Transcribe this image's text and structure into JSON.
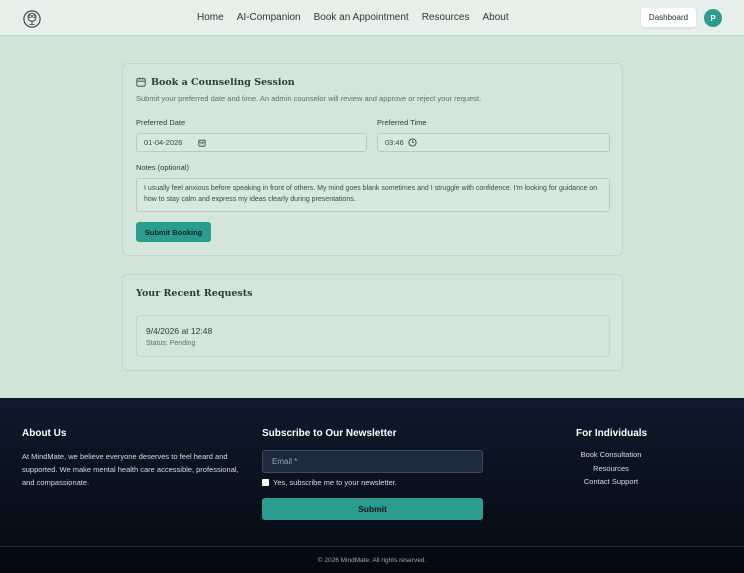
{
  "header": {
    "nav": [
      "Home",
      "AI-Companion",
      "Book an Appointment",
      "Resources",
      "About"
    ],
    "dashboard_label": "Dashboard",
    "avatar_initial": "P"
  },
  "booking": {
    "title": "Book a Counseling Session",
    "subtitle": "Submit your preferred date and time. An admin counselor will review and approve or reject your request.",
    "date_label": "Preferred Date",
    "date_value": "01-04-2026",
    "time_label": "Preferred Time",
    "time_value": "03:46",
    "notes_label": "Notes (optional)",
    "notes_value": "I usually feel anxious before speaking in front of others. My mind goes blank sometimes and I struggle with confidence. I'm looking for guidance on how to stay calm and express my ideas clearly during presentations.",
    "submit_label": "Submit Booking"
  },
  "requests": {
    "title": "Your Recent Requests",
    "items": [
      {
        "datetime": "9/4/2026 at 12:48",
        "status": "Status: Pending"
      }
    ]
  },
  "footer": {
    "about_title": "About Us",
    "about_text": "At MindMate, we believe everyone deserves to feel heard and supported. We make mental health care accessible, professional, and compassionate.",
    "newsletter_title": "Subscribe to Our Newsletter",
    "email_placeholder": "Email *",
    "subscribe_checkbox_label": "Yes, subscribe me to your newsletter.",
    "submit_label": "Submit",
    "individuals_title": "For Individuals",
    "links": [
      "Book Consultation",
      "Resources",
      "Contact Support"
    ],
    "copyright": "© 2026 MindMate. All rights reserved."
  },
  "colors": {
    "accent": "#2a9d8f",
    "page_bg": "#d2e3d8",
    "footer_bg": "#0f1a2c"
  }
}
